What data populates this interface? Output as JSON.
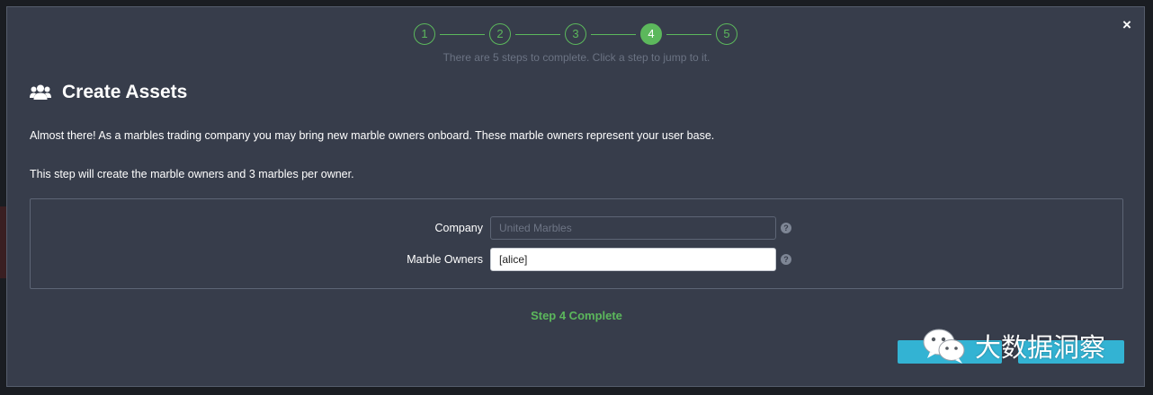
{
  "modal": {
    "close_label": "×"
  },
  "stepper": {
    "steps": [
      "1",
      "2",
      "3",
      "4",
      "5"
    ],
    "active_step": "4",
    "hint": "There are 5 steps to complete. Click a step to jump to it."
  },
  "content": {
    "icon": "users-icon",
    "title": "Create Assets",
    "paragraph1": "Almost there! As a marbles trading company you may bring new marble owners onboard. These marble owners represent your user base.",
    "paragraph2": "This step will create the marble owners and 3 marbles per owner."
  },
  "form": {
    "company_label": "Company",
    "company_placeholder": "United Marbles",
    "company_value": "",
    "owners_label": "Marble Owners",
    "owners_value": "[alice]",
    "help_icon": "question-circle-icon",
    "help_glyph": "?"
  },
  "status": {
    "step_complete": "Step 4 Complete"
  },
  "watermark": {
    "text": "大数据洞察",
    "icon": "wechat-icon"
  },
  "colors": {
    "accent_green": "#5cb85c",
    "button_cyan": "#33b3d3",
    "modal_bg": "#373d4b"
  }
}
